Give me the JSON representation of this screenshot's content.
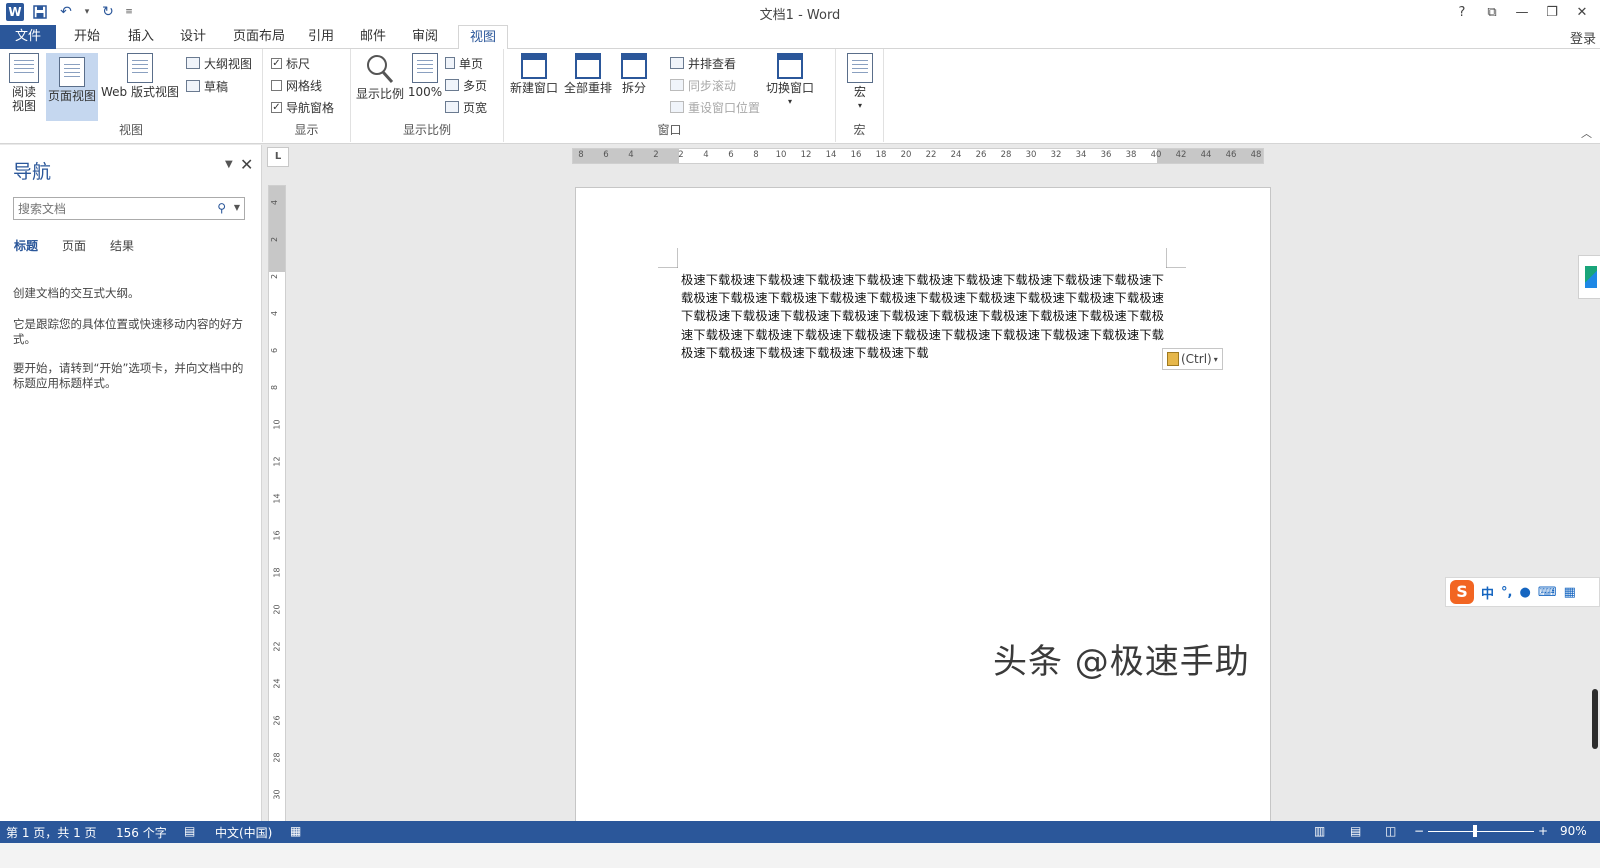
{
  "window": {
    "title": "文档1 - Word",
    "qat": {
      "logo": "W",
      "save_icon": "save-icon",
      "undo_icon": "undo-icon",
      "redo_icon": "redo-icon"
    },
    "controls": {
      "help": "?",
      "ribbon_display": "⧉",
      "minimize": "—",
      "restore": "❐",
      "close": "✕"
    }
  },
  "tabs": {
    "file": "文件",
    "home": "开始",
    "insert": "插入",
    "design": "设计",
    "layout": "页面布局",
    "references": "引用",
    "mailings": "邮件",
    "review": "审阅",
    "view": "视图",
    "login": "登录"
  },
  "ribbon": {
    "views": {
      "label": "视图",
      "read_mode_1": "阅读",
      "read_mode_2": "视图",
      "print_layout": "页面视图",
      "web_layout": "Web 版式视图",
      "outline": "大纲视图",
      "draft": "草稿"
    },
    "show": {
      "label": "显示",
      "ruler": "标尺",
      "gridlines": "网格线",
      "nav_pane": "导航窗格"
    },
    "zoom": {
      "label": "显示比例",
      "zoom": "显示比例",
      "percent": "100%",
      "one_page": "单页",
      "multiple": "多页",
      "page_width": "页宽"
    },
    "window": {
      "label": "窗口",
      "new_window": "新建窗口",
      "arrange_all": "全部重排",
      "split": "拆分",
      "side_by_side": "并排查看",
      "sync_scroll": "同步滚动",
      "reset_position": "重设窗口位置",
      "switch_windows": "切换窗口"
    },
    "macros": {
      "label": "宏",
      "macros": "宏"
    }
  },
  "nav": {
    "title": "导航",
    "search_placeholder": "搜索文档",
    "tabs": {
      "headings": "标题",
      "pages": "页面",
      "results": "结果"
    },
    "hint1": "创建文档的交互式大纲。",
    "hint2": "它是跟踪您的具体位置或快速移动内容的好方式。",
    "hint3": "要开始，请转到“开始”选项卡，并向文档中的标题应用标题样式。"
  },
  "rulers": {
    "tab_selector": "L",
    "horizontal_ticks": [
      "8",
      "6",
      "4",
      "2",
      "2",
      "4",
      "6",
      "8",
      "10",
      "12",
      "14",
      "16",
      "18",
      "20",
      "22",
      "24",
      "26",
      "28",
      "30",
      "32",
      "34",
      "36",
      "38",
      "40",
      "42",
      "44",
      "46",
      "48"
    ],
    "vertical_ticks": [
      "4",
      "2",
      "2",
      "4",
      "6",
      "8",
      "10",
      "12",
      "14",
      "16",
      "18",
      "20",
      "22",
      "24",
      "26",
      "28",
      "30"
    ]
  },
  "document": {
    "text": "极速下载极速下载极速下载极速下载极速下载极速下载极速下载极速下载极速下载极速下载极速下载极速下载极速下载极速下载极速下载极速下载极速下载极速下载极速下载极速下载极速下载极速下载极速下载极速下载极速下载极速下载极速下载极速下载极速下载极速下载极速下载极速下载极速下载极速下载极速下载极速下载极速下载极速下载极速下载极速下载极速下载极速下载极速下载极速下载",
    "paste_options": "(Ctrl)"
  },
  "ime": {
    "logo": "S",
    "lang": "中",
    "punct": "°,",
    "mic": "🎤",
    "keyboard": "⌨",
    "grid": "▦"
  },
  "watermark": "头条 @极速手助",
  "status": {
    "page": "第 1 页，共 1 页",
    "words": "156 个字",
    "language": "中文(中国)",
    "zoom_percent": "90%",
    "zoom_value": 90,
    "zoom_minus": "−",
    "zoom_plus": "+"
  }
}
